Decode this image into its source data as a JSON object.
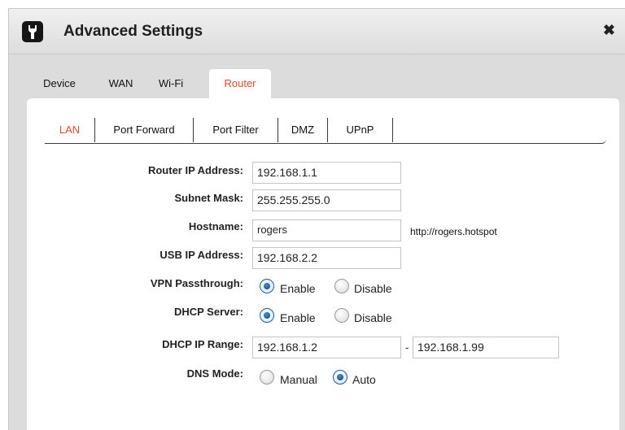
{
  "window": {
    "title": "Advanced Settings",
    "close_glyph": "✖"
  },
  "tabs": [
    "Device",
    "WAN",
    "Wi-Fi",
    "Router"
  ],
  "active_tab": "Router",
  "subtabs": [
    "LAN",
    "Port Forward",
    "Port Filter",
    "DMZ",
    "UPnP"
  ],
  "active_subtab": "LAN",
  "form": {
    "router_ip": {
      "label": "Router IP Address:",
      "value": "192.168.1.1"
    },
    "subnet_mask": {
      "label": "Subnet Mask:",
      "value": "255.255.255.0"
    },
    "hostname": {
      "label": "Hostname:",
      "value": "rogers",
      "helper": "http://rogers.hotspot"
    },
    "usb_ip": {
      "label": "USB IP Address:",
      "value": "192.168.2.2"
    },
    "vpn_passthrough": {
      "label": "VPN Passthrough:",
      "options": [
        "Enable",
        "Disable"
      ],
      "selected": "Enable"
    },
    "dhcp_server": {
      "label": "DHCP Server:",
      "options": [
        "Enable",
        "Disable"
      ],
      "selected": "Enable"
    },
    "dhcp_range": {
      "label": "DHCP IP Range:",
      "start": "192.168.1.2",
      "separator": "-",
      "end": "192.168.1.99"
    },
    "dns_mode": {
      "label": "DNS Mode:",
      "options": [
        "Manual",
        "Auto"
      ],
      "selected": "Auto"
    }
  },
  "colors": {
    "accent": "#e14a2a",
    "radio_selected": "#1f5f9a"
  },
  "icons": {
    "title_icon": "wrench-icon",
    "close_icon": "close-icon"
  }
}
